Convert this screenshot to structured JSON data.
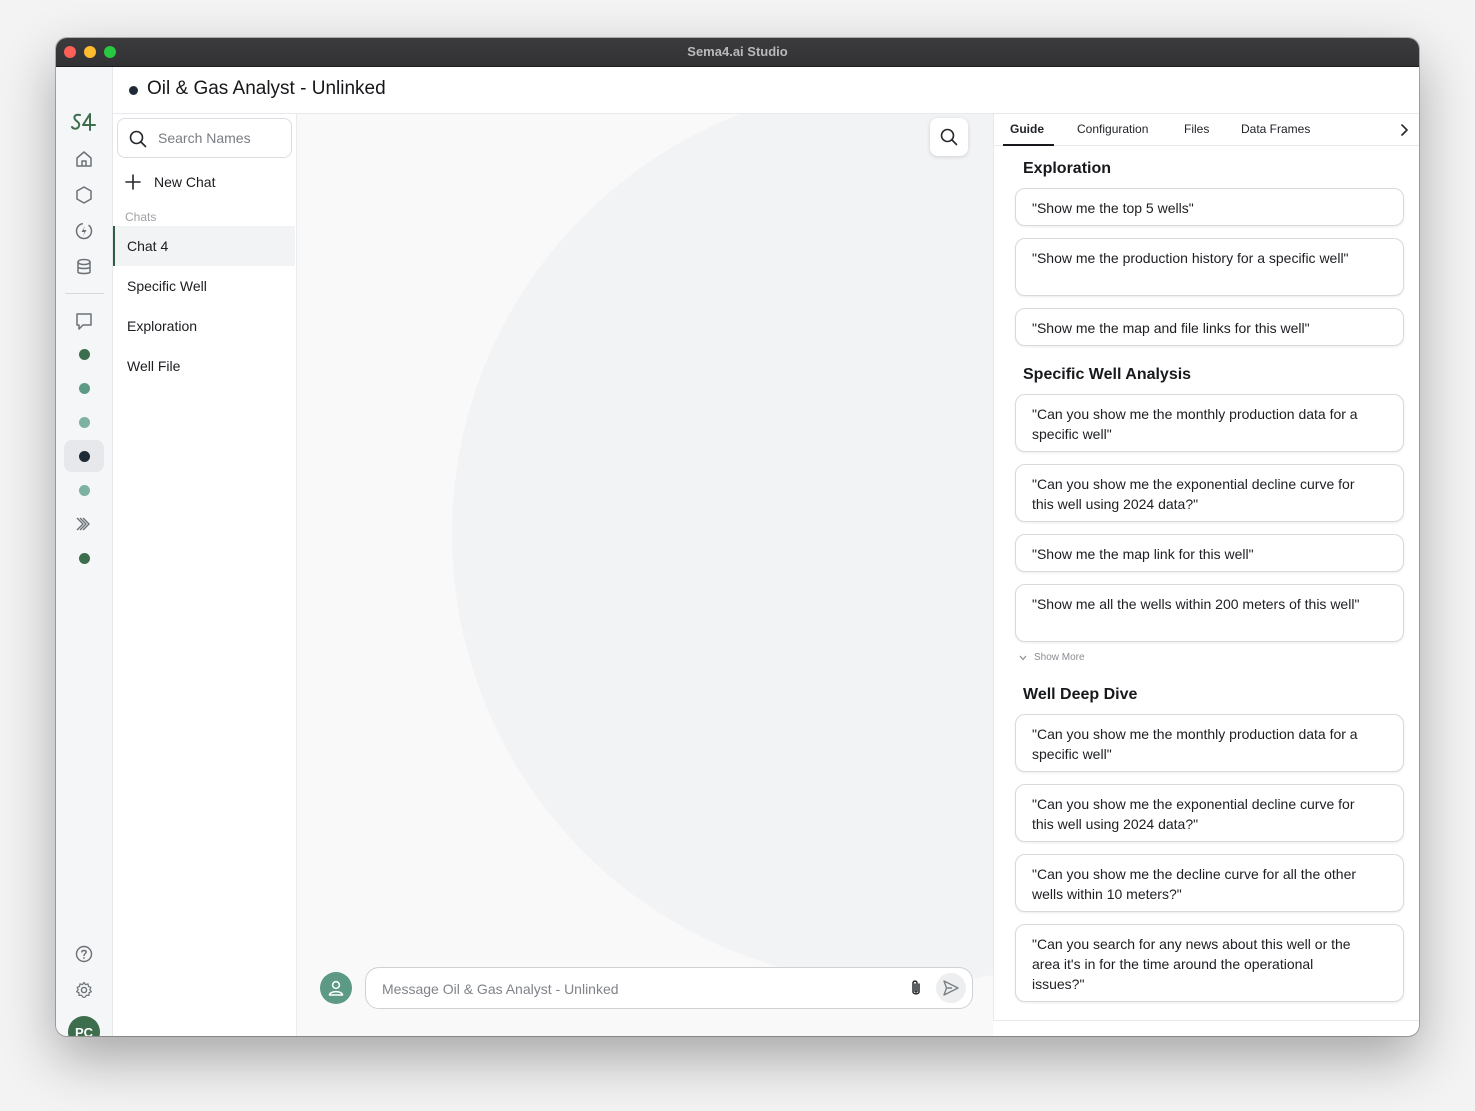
{
  "window": {
    "title": "Sema4.ai Studio"
  },
  "rail": {
    "logo_text": "S4",
    "avatar_initials": "PC",
    "colors": {
      "dark_green": "#3c6e4d",
      "teal": "#5d9a86",
      "light_teal": "#7db1a1",
      "navy": "#1f2a37"
    }
  },
  "header": {
    "agent_name": "Oil & Gas Analyst - Unlinked"
  },
  "sidebar": {
    "search_placeholder": "Search Names",
    "new_chat_label": "New Chat",
    "section_label": "Chats",
    "chats": [
      {
        "label": "Chat 4",
        "active": true
      },
      {
        "label": "Specific Well"
      },
      {
        "label": "Exploration"
      },
      {
        "label": "Well File"
      }
    ]
  },
  "composer": {
    "placeholder": "Message Oil & Gas Analyst - Unlinked"
  },
  "guide": {
    "tabs": [
      "Guide",
      "Configuration",
      "Files",
      "Data Frames"
    ],
    "active_tab": "Guide",
    "show_more_label": "Show More",
    "sections": [
      {
        "title": "Exploration",
        "prompts": [
          "\"Show me the top 5 wells\"",
          "\"Show me the production history for a specific well\"",
          "\"Show me the map and file links for this well\""
        ]
      },
      {
        "title": "Specific Well Analysis",
        "prompts": [
          "\"Can you show me the monthly production data for a specific well\"",
          "\"Can you show me the exponential decline curve for this well using 2024 data?\"",
          "\"Show me the map link for this well\"",
          "\"Show me all the wells within 200 meters of this well\""
        ]
      },
      {
        "title": "Well Deep Dive",
        "prompts": [
          "\"Can you show me the monthly production data for a specific well\"",
          "\"Can you show me the exponential decline curve for this well using 2024 data?\"",
          "\"Can you show me the decline curve for all the other wells within 10 meters?\"",
          "\"Can you search for any news about this well or the area it's in for the time around the operational issues?\""
        ]
      }
    ]
  }
}
